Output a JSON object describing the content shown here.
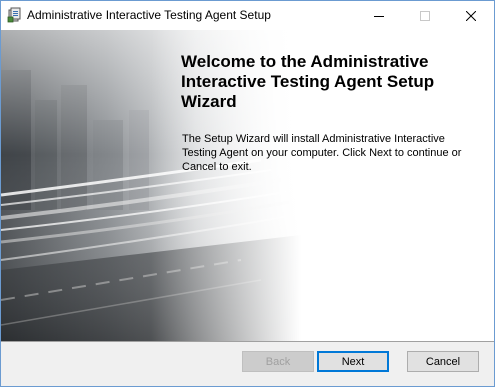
{
  "window": {
    "title": "Administrative Interactive Testing Agent Setup",
    "app_icon": "installer-icon",
    "controls": {
      "minimize_icon": "minimize-icon",
      "maximize_icon": "maximize-icon",
      "close_icon": "close-icon"
    }
  },
  "wizard": {
    "heading": "Welcome to the Administrative Interactive Testing Agent Setup Wizard",
    "description": "The Setup Wizard will install Administrative Interactive Testing Agent on your computer. Click Next to continue or Cancel to exit.",
    "banner": "highway-light-trails-image"
  },
  "buttons": {
    "back_label": "Back",
    "back_enabled": false,
    "next_label": "Next",
    "cancel_label": "Cancel"
  },
  "colors": {
    "window_border": "#6b9bd1",
    "footer_background": "#f0f0f0",
    "default_button_border": "#0078d7"
  }
}
